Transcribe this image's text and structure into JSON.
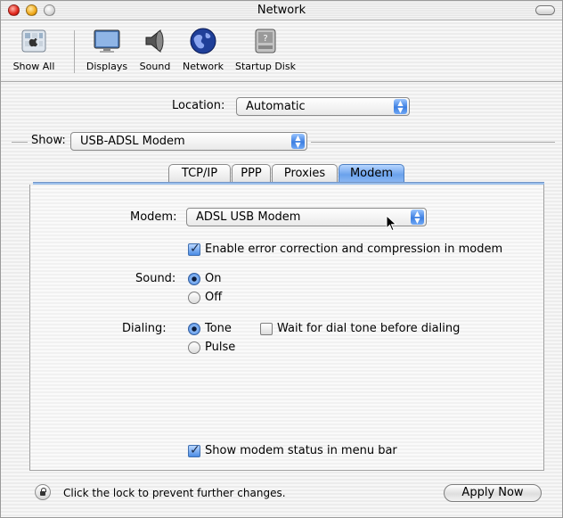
{
  "window": {
    "title": "Network"
  },
  "toolbar": {
    "items": [
      {
        "label": "Show All",
        "icon": "apple-prefs-icon"
      },
      {
        "label": "Displays",
        "icon": "display-icon"
      },
      {
        "label": "Sound",
        "icon": "speaker-icon"
      },
      {
        "label": "Network",
        "icon": "globe-icon"
      },
      {
        "label": "Startup Disk",
        "icon": "disk-icon"
      }
    ]
  },
  "location": {
    "label": "Location:",
    "value": "Automatic"
  },
  "show": {
    "label": "Show:",
    "value": "USB-ADSL Modem"
  },
  "tabs": [
    {
      "label": "TCP/IP",
      "active": false
    },
    {
      "label": "PPP",
      "active": false
    },
    {
      "label": "Proxies",
      "active": false
    },
    {
      "label": "Modem",
      "active": true
    }
  ],
  "modem": {
    "label": "Modem:",
    "value": "ADSL USB Modem",
    "error_correction": {
      "label": "Enable error correction and compression in modem",
      "checked": true
    },
    "sound": {
      "label": "Sound:",
      "on": "On",
      "off": "Off",
      "selected": "On"
    },
    "dialing": {
      "label": "Dialing:",
      "tone": "Tone",
      "pulse": "Pulse",
      "selected": "Tone"
    },
    "wait_dial_tone": {
      "label": "Wait for dial tone before dialing",
      "checked": false
    },
    "show_status": {
      "label": "Show modem status in menu bar",
      "checked": true
    }
  },
  "footer": {
    "lock_text": "Click the lock to prevent further changes.",
    "apply_label": "Apply Now"
  },
  "colors": {
    "accent": "#3d7fe1",
    "tab_active": "#6aa2ec"
  }
}
